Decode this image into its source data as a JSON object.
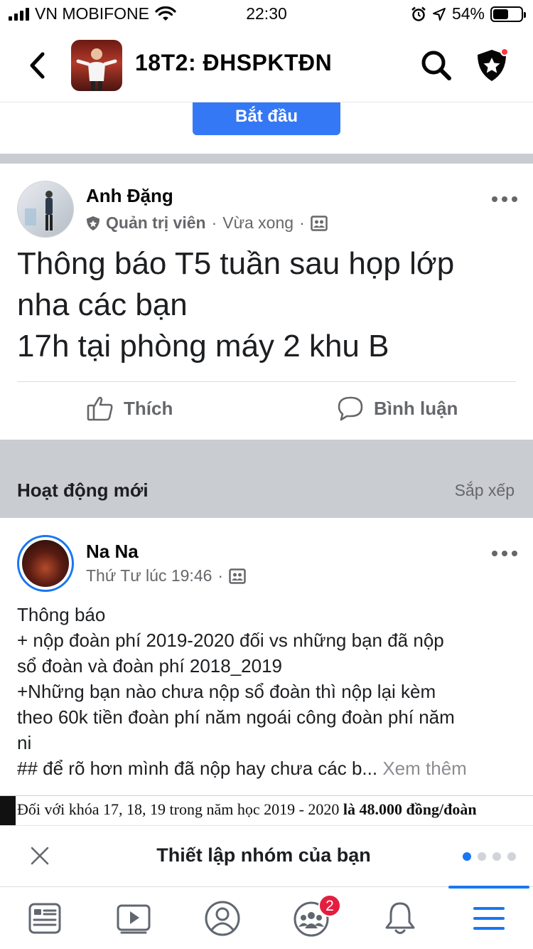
{
  "status_bar": {
    "carrier": "VN MOBIFONE",
    "time": "22:30",
    "battery": "54%",
    "battery_level": 0.54
  },
  "header": {
    "group_name": "18T2: ĐHSPKTĐN",
    "icons": [
      "back-icon",
      "search-icon",
      "shield-star-icon"
    ]
  },
  "start_button": {
    "label": "Bắt đầu"
  },
  "post1": {
    "author": "Anh Đặng",
    "role": "Quản trị viên",
    "time": "Vừa xong",
    "lines": [
      "Thông báo T5 tuần sau họp lớp",
      "nha các bạn",
      "17h tại phòng máy 2 khu B"
    ],
    "like_label": "Thích",
    "comment_label": "Bình luận"
  },
  "activity": {
    "title": "Hoạt động mới",
    "sort_label": "Sắp xếp"
  },
  "post2": {
    "author": "Na Na",
    "time": "Thứ Tư lúc 19:46",
    "lines": [
      "Thông báo",
      "+ nộp đoàn phí 2019-2020 đối vs những bạn đã nộp",
      "sổ đoàn và đoàn phí 2018_2019",
      "+Những bạn nào chưa nộp sổ đoàn thì nộp lại kèm",
      "theo 60k tiền đoàn phí năm ngoái công đoàn phí năm",
      "ni",
      "## để rõ hơn mình đã nộp hay chưa các b..."
    ],
    "see_more": "Xem thêm",
    "doc_text": "Đối với khóa 17, 18, 19 trong năm học 2019 - 2020 ",
    "doc_bold": "là 48.000 đồng/đoàn"
  },
  "setup_banner": {
    "title": "Thiết lập nhóm của bạn",
    "page_count": 4,
    "active_page": 1
  },
  "tabbar": {
    "items": [
      "feed-icon",
      "watch-icon",
      "profile-icon",
      "groups-icon",
      "notifications-icon",
      "menu-icon"
    ],
    "groups_badge": "2",
    "active_tab": "menu-icon"
  },
  "colors": {
    "accent": "#1877f2",
    "start_button": "#3578f5",
    "badge": "#e41e3f",
    "divider": "#c9ccd1",
    "muted_text": "#65676b"
  }
}
